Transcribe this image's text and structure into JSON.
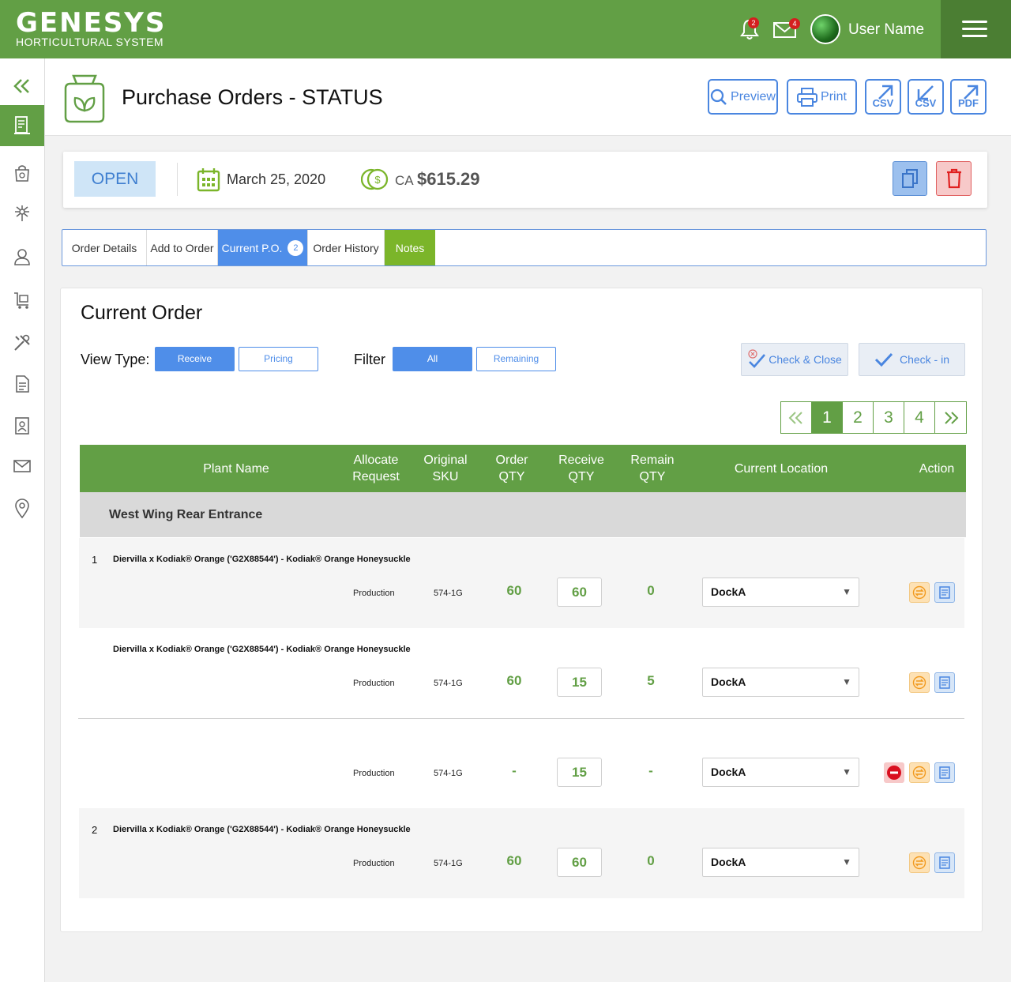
{
  "header": {
    "logo_main": "GENESYS",
    "logo_sub": "HORTICULTURAL SYSTEM",
    "notification_count": "2",
    "message_count": "4",
    "user_name": "User Name"
  },
  "page": {
    "title": "Purchase Orders - STATUS",
    "toolbar": {
      "preview": "Preview",
      "print": "Print",
      "csv_export": "CSV",
      "csv_import": "CSV",
      "pdf": "PDF"
    }
  },
  "status": {
    "state": "OPEN",
    "date": "March 25, 2020",
    "currency": "CA",
    "amount": "$615.29"
  },
  "tabs": [
    {
      "label": "Order Details"
    },
    {
      "label": "Add to Order"
    },
    {
      "label": "Current P.O.",
      "count": "2"
    },
    {
      "label": "Order History"
    },
    {
      "label": "Notes"
    }
  ],
  "main": {
    "title": "Current Order",
    "view_type_label": "View Type:",
    "view_receive": "Receive",
    "view_pricing": "Pricing",
    "filter_label": "Filter",
    "filter_all": "All",
    "filter_remaining": "Remaining",
    "check_close": "Check & Close",
    "check_in": "Check - in",
    "pages": [
      "1",
      "2",
      "3",
      "4"
    ],
    "columns": {
      "plant_name": "Plant Name",
      "allocate": [
        "Allocate",
        "Request"
      ],
      "sku": [
        "Original",
        "SKU"
      ],
      "order_qty": [
        "Order",
        "QTY"
      ],
      "receive_qty": [
        "Receive",
        "QTY"
      ],
      "remain_qty": [
        "Remain",
        "QTY"
      ],
      "location": "Current Location",
      "action": "Action"
    },
    "group": "West Wing Rear Entrance",
    "rows": [
      {
        "num": "1",
        "name": "Diervilla x Kodiak® Orange ('G2X88544') - Kodiak® Orange Honeysuckle",
        "allocate": "Production",
        "sku": "574-1G",
        "order": "60",
        "receive": "60",
        "remain": "0",
        "location": "DockA"
      },
      {
        "num": "",
        "name": "Diervilla x Kodiak® Orange ('G2X88544') - Kodiak® Orange Honeysuckle",
        "allocate": "Production",
        "sku": "574-1G",
        "order": "60",
        "receive": "15",
        "remain": "5",
        "location": "DockA"
      },
      {
        "num": "",
        "name": "",
        "allocate": "Production",
        "sku": "574-1G",
        "order": "-",
        "receive": "15",
        "remain": "-",
        "location": "DockA"
      },
      {
        "num": "2",
        "name": "Diervilla x Kodiak® Orange ('G2X88544') - Kodiak® Orange Honeysuckle",
        "allocate": "Production",
        "sku": "574-1G",
        "order": "60",
        "receive": "60",
        "remain": "0",
        "location": "DockA"
      }
    ]
  },
  "colors": {
    "brand_green": "#629f45",
    "dark_green": "#4b7e33",
    "accent_blue": "#4f8ee9",
    "notes_green": "#7bb52a",
    "badge_red": "#d41f1f"
  },
  "icons": [
    "bell-icon",
    "mail-icon",
    "hamburger-icon",
    "collapse-icon",
    "bag-leaf-icon",
    "calendar-icon",
    "coins-icon",
    "copy-icon",
    "trash-icon",
    "swap-icon",
    "document-icon",
    "remove-icon"
  ]
}
